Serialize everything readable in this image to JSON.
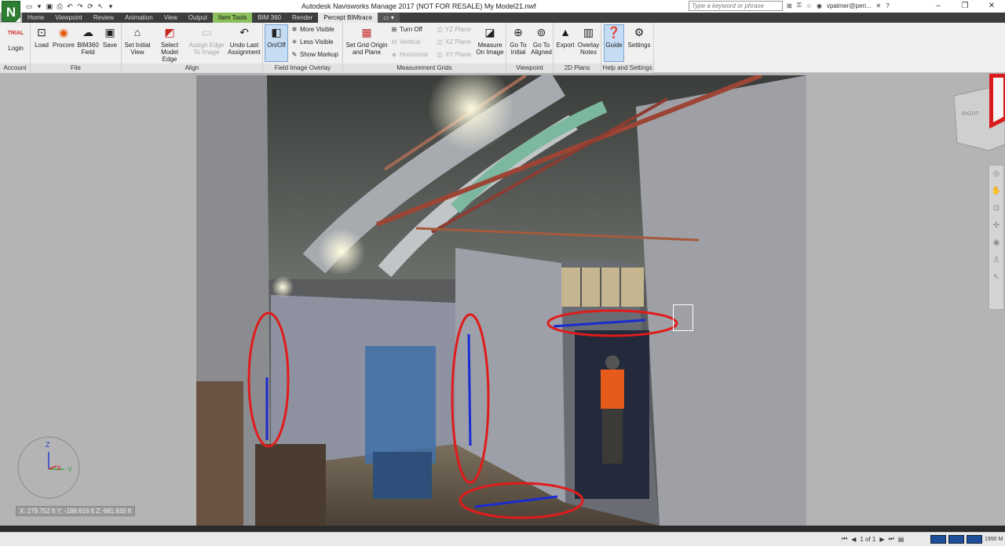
{
  "window": {
    "title": "Autodesk Navisworks Manage 2017 (NOT FOR RESALE)    My Model21.nwf",
    "app_logo": "N",
    "search_placeholder": "Type a keyword or phrase",
    "user": "vpalmer@peri...",
    "help": "?"
  },
  "tabs": [
    {
      "label": "Home",
      "state": "normal"
    },
    {
      "label": "Viewpoint",
      "state": "normal"
    },
    {
      "label": "Review",
      "state": "normal"
    },
    {
      "label": "Animation",
      "state": "normal"
    },
    {
      "label": "View",
      "state": "normal"
    },
    {
      "label": "Output",
      "state": "normal"
    },
    {
      "label": "Item Tools",
      "state": "context"
    },
    {
      "label": "BIM 360",
      "state": "normal"
    },
    {
      "label": "Render",
      "state": "normal"
    },
    {
      "label": "Percept BIMtrace",
      "state": "active"
    }
  ],
  "ribbon": {
    "account": {
      "label": "Account",
      "trial_badge": "TRIAL",
      "login": "Login"
    },
    "file": {
      "label": "File",
      "load": "Load",
      "procore": "Procore",
      "bim360_field": "BIM360 Field",
      "save": "Save"
    },
    "align": {
      "label": "Align",
      "set_initial_view": "Set Initial View",
      "select_model_edge": "Select Model Edge",
      "assign_edge": "Assign Edge To Image",
      "undo_last": "Undo Last Assignment"
    },
    "overlay": {
      "label": "Field Image Overlay",
      "on_off": "On/Off",
      "more_visible": "More Visible",
      "less_visible": "Less Visible",
      "show_markup": "Show Markup"
    },
    "grids": {
      "label": "Measurement Grids",
      "set_grid": "Set Grid Origin and Plane",
      "turn_off": "Turn Off",
      "vertical": "Vertical",
      "horizontal": "Horizontal",
      "yz_plane": "YZ Plane",
      "xz_plane": "XZ Plane",
      "xy_plane": "XY Plane",
      "measure": "Measure On Image"
    },
    "viewpoint": {
      "label": "Viewpoint",
      "go_initial": "Go To Initial",
      "go_aligned": "Go To Aligned"
    },
    "plans": {
      "label": "2D Plans",
      "export": "Export",
      "overlay_notes": "Overlay Notes"
    },
    "help": {
      "label": "Help and Settings",
      "guide": "Guide",
      "settings": "Settings"
    }
  },
  "viewport": {
    "coordinates": "X: 279.752 ft  Y: -188.616 ft  Z: 681.920 ft",
    "viewcube_face": "RIGHT",
    "axis_x": "X",
    "axis_y": "Y",
    "axis_z": "Z"
  },
  "statusbar": {
    "page": "1 of 1",
    "memory": "1990 M"
  },
  "colors": {
    "tab_bar": "#3d3d3d",
    "context_tab": "#8cbf5d",
    "markup_red": "#e01b1b",
    "edge_blue": "#1a2bd1",
    "selected_button": "#c5dcf2"
  }
}
